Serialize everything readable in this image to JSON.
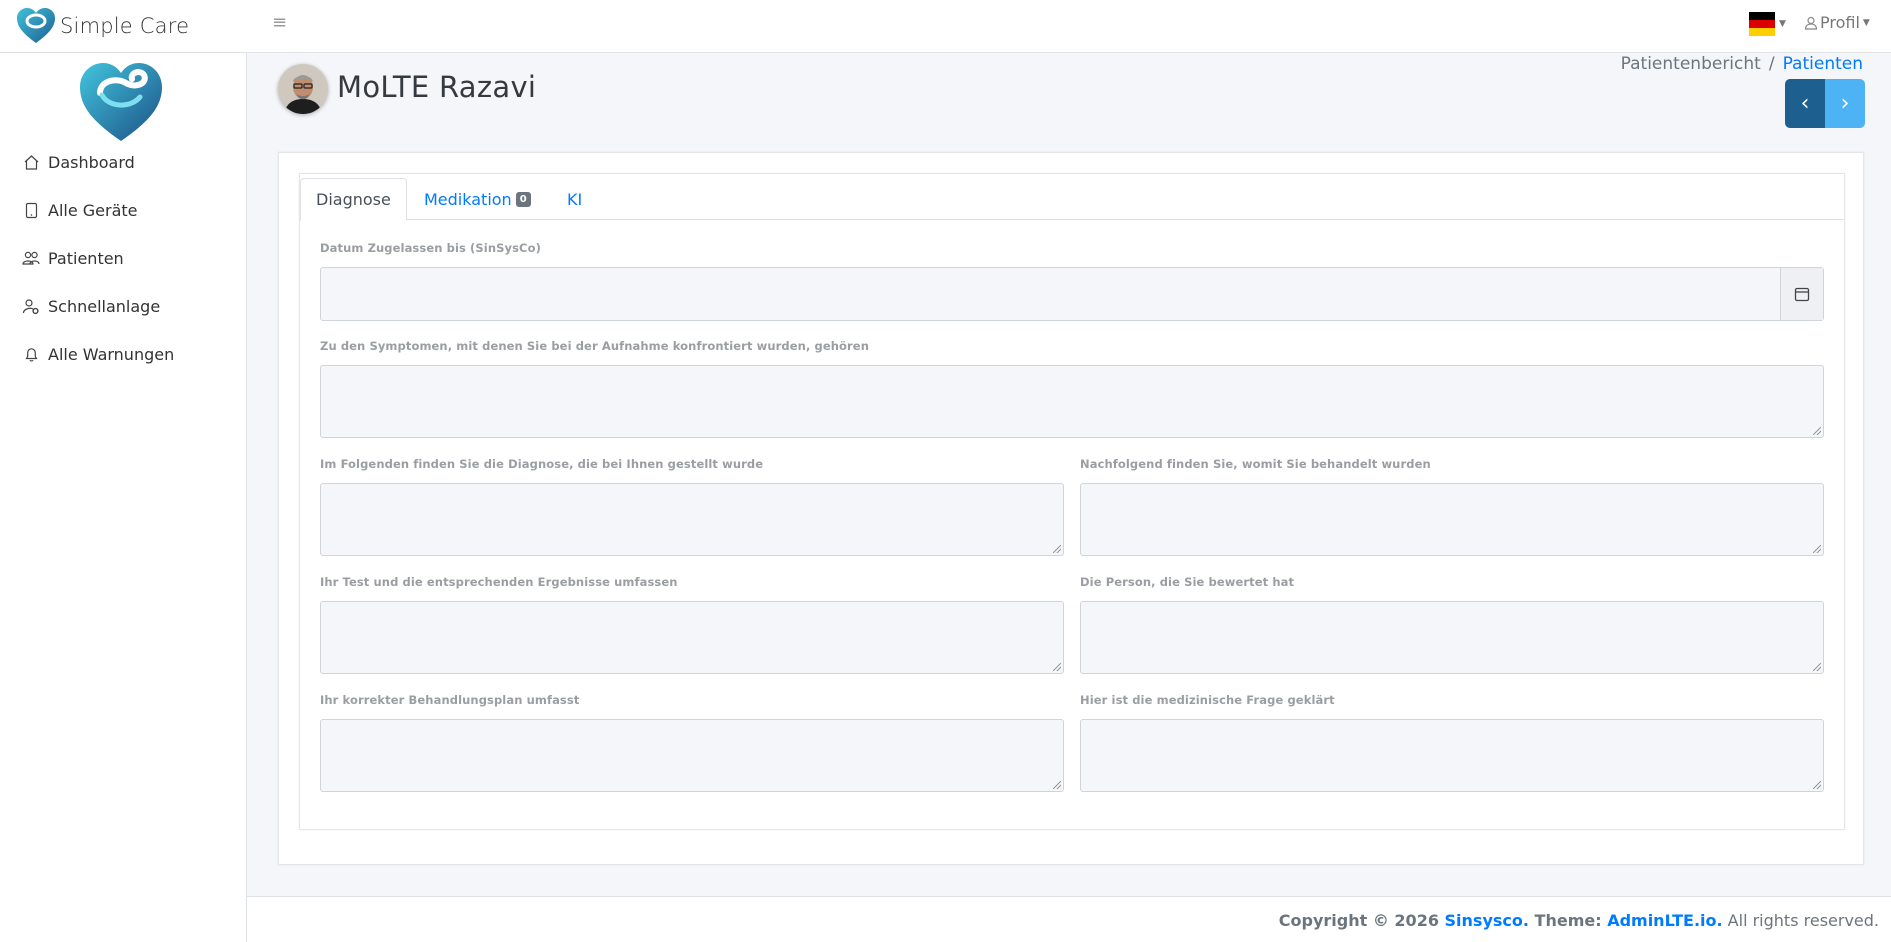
{
  "brand": {
    "name": "Simple Care"
  },
  "topbar": {
    "profile_label": "Profil"
  },
  "colors": {
    "accent": "#007bff",
    "pager_prev": "#1d5f8f",
    "pager_next": "#4db3f5",
    "flag": [
      "#000000",
      "#dd0000",
      "#ffce00"
    ]
  },
  "sidebar": {
    "items": [
      {
        "label": "Dashboard",
        "icon": "house-icon"
      },
      {
        "label": "Alle Geräte",
        "icon": "tablet-icon"
      },
      {
        "label": "Patienten",
        "icon": "people-icon"
      },
      {
        "label": "Schnellanlage",
        "icon": "person-gear-icon"
      },
      {
        "label": "Alle Warnungen",
        "icon": "bell-icon"
      }
    ]
  },
  "header": {
    "title": "MoLTE Razavi",
    "breadcrumb": {
      "parent": "Patientenbericht",
      "current": "Patienten"
    },
    "pager": {
      "prev": "‹",
      "next": "›"
    }
  },
  "tabs": [
    {
      "label": "Diagnose",
      "active": true
    },
    {
      "label": "Medikation",
      "badge": "0"
    },
    {
      "label": "KI"
    }
  ],
  "form": {
    "date_label": "Datum Zugelassen bis (SinSysCo)",
    "symptoms_label": "Zu den Symptomen, mit denen Sie bei der Aufnahme konfrontiert wurden, gehören",
    "diagnosis_label": "Im Folgenden finden Sie die Diagnose, die bei Ihnen gestellt wurde",
    "treated_label": "Nachfolgend finden Sie, womit Sie behandelt wurden",
    "tests_label": "Ihr Test und die entsprechenden Ergebnisse umfassen",
    "evaluator_label": "Die Person, die Sie bewertet hat",
    "plan_label": "Ihr korrekter Behandlungsplan umfasst",
    "question_label": "Hier ist die medizinische Frage geklärt"
  },
  "footer": {
    "prefix": "Copyright © 2026 ",
    "company": "Sinsysco.",
    "theme_prefix": " Theme: ",
    "theme": "AdminLTE.io.",
    "suffix": " All rights reserved."
  }
}
